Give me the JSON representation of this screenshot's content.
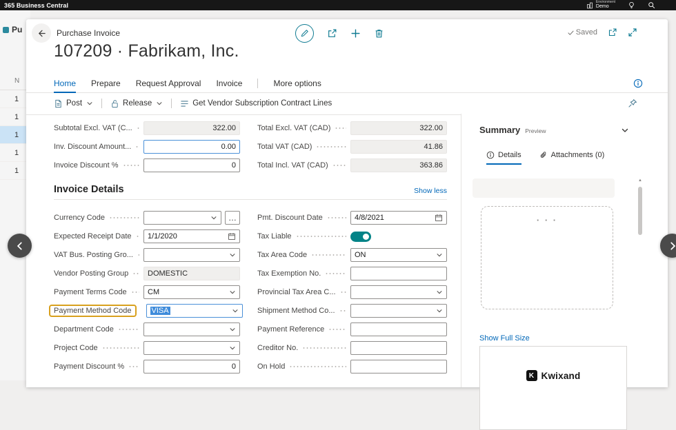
{
  "topbar": {
    "app_title": "365 Business Central",
    "environment": {
      "label": "Environment",
      "name": "Demo"
    }
  },
  "bg_list": {
    "page_title_partial": "Pu",
    "col_header_partial": "N",
    "rows": [
      {
        "no": "1",
        "selected": false
      },
      {
        "no": "1",
        "selected": false
      },
      {
        "no": "1",
        "selected": true
      },
      {
        "no": "1",
        "selected": false
      },
      {
        "no": "1",
        "selected": false
      }
    ]
  },
  "header": {
    "breadcrumb": "Purchase Invoice",
    "title": "107209 · Fabrikam, Inc.",
    "saved": "Saved"
  },
  "menu": {
    "tabs": [
      "Home",
      "Prepare",
      "Request Approval",
      "Invoice"
    ],
    "active": "Home",
    "more": "More options"
  },
  "actions": [
    {
      "label": "Post",
      "icon": "post-icon",
      "dropdown": true
    },
    {
      "label": "Release",
      "icon": "release-icon",
      "dropdown": true
    },
    {
      "label": "Get Vendor Subscription Contract Lines",
      "icon": "contract-lines-icon",
      "dropdown": false
    }
  ],
  "totals": {
    "left": [
      {
        "label": "Subtotal Excl. VAT (C...",
        "value": "322.00",
        "type": "disabled",
        "align": "right"
      },
      {
        "label": "Inv. Discount Amount...",
        "value": "0.00",
        "type": "number",
        "focused": true
      },
      {
        "label": "Invoice Discount %",
        "value": "0",
        "type": "number"
      }
    ],
    "right": [
      {
        "label": "Total Excl. VAT (CAD)",
        "value": "322.00",
        "type": "disabled",
        "align": "right"
      },
      {
        "label": "Total VAT (CAD)",
        "value": "41.86",
        "type": "disabled",
        "align": "right"
      },
      {
        "label": "Total Incl. VAT (CAD)",
        "value": "363.86",
        "type": "disabled",
        "align": "right"
      }
    ]
  },
  "details": {
    "title": "Invoice Details",
    "show_less": "Show less",
    "left": [
      {
        "label": "Currency Code",
        "value": "",
        "type": "combo-assist"
      },
      {
        "label": "Expected Receipt Date",
        "value": "1/1/2020",
        "type": "date"
      },
      {
        "label": "VAT Bus. Posting Gro...",
        "value": "",
        "type": "combo"
      },
      {
        "label": "Vendor Posting Group",
        "value": "DOMESTIC",
        "type": "disabled"
      },
      {
        "label": "Payment Terms Code",
        "value": "CM",
        "type": "combo"
      },
      {
        "label": "Payment Method Code",
        "value": "VISA",
        "type": "combo",
        "label_highlight": true,
        "value_selected": true,
        "focused": true
      },
      {
        "label": "Department Code",
        "value": "",
        "type": "combo"
      },
      {
        "label": "Project Code",
        "value": "",
        "type": "combo"
      },
      {
        "label": "Payment Discount %",
        "value": "0",
        "type": "number"
      }
    ],
    "right": [
      {
        "label": "Pmt. Discount Date",
        "value": "4/8/2021",
        "type": "date"
      },
      {
        "label": "Tax Liable",
        "value": true,
        "type": "toggle"
      },
      {
        "label": "Tax Area Code",
        "value": "ON",
        "type": "combo"
      },
      {
        "label": "Tax Exemption No.",
        "value": "",
        "type": "text"
      },
      {
        "label": "Provincial Tax Area C...",
        "value": "",
        "type": "combo"
      },
      {
        "label": "Shipment Method Co...",
        "value": "",
        "type": "combo"
      },
      {
        "label": "Payment Reference",
        "value": "",
        "type": "text"
      },
      {
        "label": "Creditor No.",
        "value": "",
        "type": "text"
      },
      {
        "label": "On Hold",
        "value": "",
        "type": "text"
      }
    ]
  },
  "factbox": {
    "title": "Summary",
    "badge": "Preview",
    "tabs": [
      {
        "label": "Details",
        "icon": "info-icon",
        "active": true
      },
      {
        "label": "Attachments (0)",
        "icon": "paperclip-icon",
        "active": false
      }
    ],
    "show_full_size": "Show Full Size",
    "logo_letter": "K",
    "vendor_logo_text": "Kwixand"
  },
  "colors": {
    "accent": "#0067b8",
    "icon": "#0f7b92",
    "tog": "#038387",
    "hl": "#d8a01d",
    "sel": "#3f8cdb",
    "focus": "#4a90d8"
  }
}
